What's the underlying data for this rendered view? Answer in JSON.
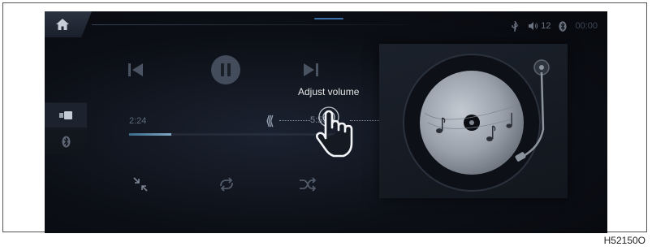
{
  "status": {
    "volume_level": "12",
    "clock": "00:00"
  },
  "player": {
    "elapsed": "2:24",
    "duration": "5:59",
    "progress_fraction": 0.2
  },
  "hint": {
    "label": "Adjust volume"
  },
  "figure_code": "H52150O",
  "icons": {
    "home": "home-icon",
    "usb": "usb-icon",
    "volume": "volume-icon",
    "bluetooth": "bluetooth-icon",
    "previous": "previous-track-icon",
    "pause": "pause-icon",
    "next": "next-track-icon",
    "shrink": "shrink-icon",
    "repeat": "repeat-icon",
    "shuffle": "shuffle-icon",
    "media_source": "media-source-icon",
    "hand": "hand-gesture-icon"
  },
  "colors": {
    "screen_bg": "#0c0f16",
    "accent": "#3b6fa8",
    "progress": "#7fa8c4"
  }
}
